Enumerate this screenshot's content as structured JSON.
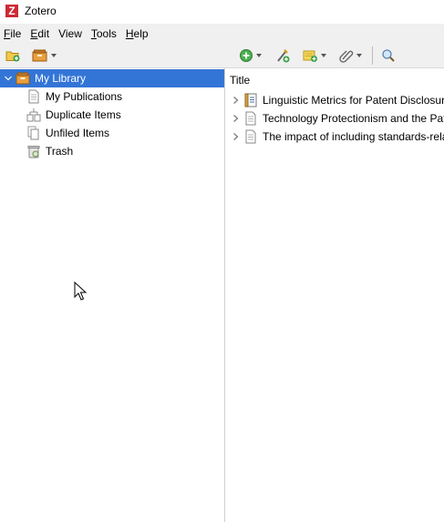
{
  "window": {
    "title": "Zotero",
    "logo_letter": "Z"
  },
  "menubar": [
    {
      "label": "File",
      "u": "F",
      "rest": "ile"
    },
    {
      "label": "Edit",
      "u": "E",
      "rest": "dit"
    },
    {
      "label": "View",
      "u": "",
      "rest": "View"
    },
    {
      "label": "Tools",
      "u": "T",
      "rest": "ools"
    },
    {
      "label": "Help",
      "u": "H",
      "rest": "elp"
    }
  ],
  "toolbar": {
    "left": [
      "new-collection-icon",
      "new-library-icon"
    ],
    "right": [
      "new-item-icon",
      "add-by-identifier-icon",
      "new-note-icon",
      "attach-icon",
      "search-icon"
    ]
  },
  "sidebar": {
    "items": [
      {
        "label": "My Library",
        "icon": "library-icon",
        "selected": true
      },
      {
        "label": "My Publications",
        "icon": "publications-icon"
      },
      {
        "label": "Duplicate Items",
        "icon": "duplicates-icon"
      },
      {
        "label": "Unfiled Items",
        "icon": "unfiled-icon"
      },
      {
        "label": "Trash",
        "icon": "trash-icon"
      }
    ]
  },
  "items_pane": {
    "column_header": "Title",
    "rows": [
      {
        "title": "Linguistic Metrics for Patent Disclosure",
        "icon": "book-icon"
      },
      {
        "title": "Technology Protectionism and the Patent",
        "icon": "document-icon"
      },
      {
        "title": "The impact of including standards-related",
        "icon": "document-icon"
      }
    ]
  },
  "colors": {
    "selection": "#3375d6",
    "menubar_bg": "#f0f0f0",
    "logo": "#cc2936"
  }
}
